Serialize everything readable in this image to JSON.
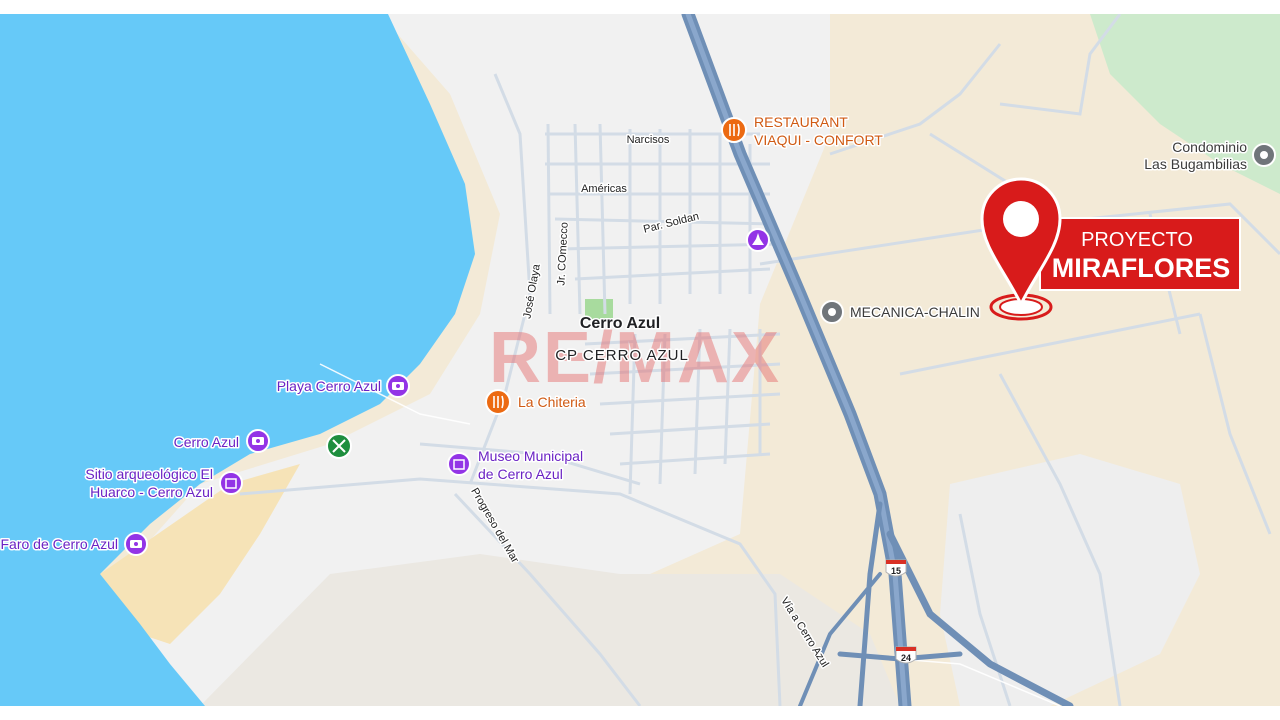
{
  "colors": {
    "water": "#66c9f8",
    "land_urban": "#f1f1f1",
    "land_rural": "#f3e9d5",
    "land_sand": "#f6e3b7",
    "park": "#cdeacc",
    "highway": "#6f8fb6",
    "road": "#d3dce6",
    "poi_purple": "#9334e6",
    "poi_orange": "#ec6a12",
    "poi_gray": "#70757a",
    "poi_green": "#1e8e3e",
    "project_red": "#d81b1b"
  },
  "town": {
    "name": "Cerro Azul",
    "district": "CP CERRO AZUL"
  },
  "watermark": {
    "text": "RE/MAX"
  },
  "project": {
    "line1": "PROYECTO",
    "line2": "MIRAFLORES",
    "icon": "map-pin-icon"
  },
  "pois": {
    "restaurant_viaqui": {
      "line1": "RESTAURANT",
      "line2": "VIAQUI - CONFORT",
      "icon": "fork-knife-icon"
    },
    "condominio": {
      "line1": "Condominio",
      "line2": "Las Bugambilias",
      "icon": "circle-pin-icon"
    },
    "mecanica": {
      "name": "MECANICA-CHALIN",
      "icon": "circle-pin-icon"
    },
    "la_chiteria": {
      "name": "La Chiteria",
      "icon": "fork-knife-icon"
    },
    "playa": {
      "name": "Playa Cerro Azul",
      "icon": "camera-icon"
    },
    "cerro_azul_viewpoint": {
      "name": "Cerro Azul",
      "icon": "camera-icon"
    },
    "sitio_arqueologico": {
      "line1": "Sitio arqueológico El",
      "line2": "Huarco - Cerro Azul",
      "icon": "museum-icon"
    },
    "faro": {
      "name": "Faro de Cerro Azul",
      "icon": "camera-icon"
    },
    "museo": {
      "line1": "Museo Municipal",
      "line2": "de Cerro Azul",
      "icon": "museum-icon"
    },
    "monument": {
      "icon": "monument-icon"
    },
    "green_poi": {
      "icon": "hammer-pick-icon"
    }
  },
  "streets": {
    "narcisos": "Narcisos",
    "americas": "Américas",
    "par_soldan": "Par. Soldan",
    "jr_comercio": "Jr. COmecco",
    "jose_olaya": "José Olaya",
    "progreso": "Progreso del Mar",
    "via_cerro_azul": "Vía a Cerro Azul"
  },
  "shields": {
    "route_15": "15",
    "route_24": "24"
  }
}
